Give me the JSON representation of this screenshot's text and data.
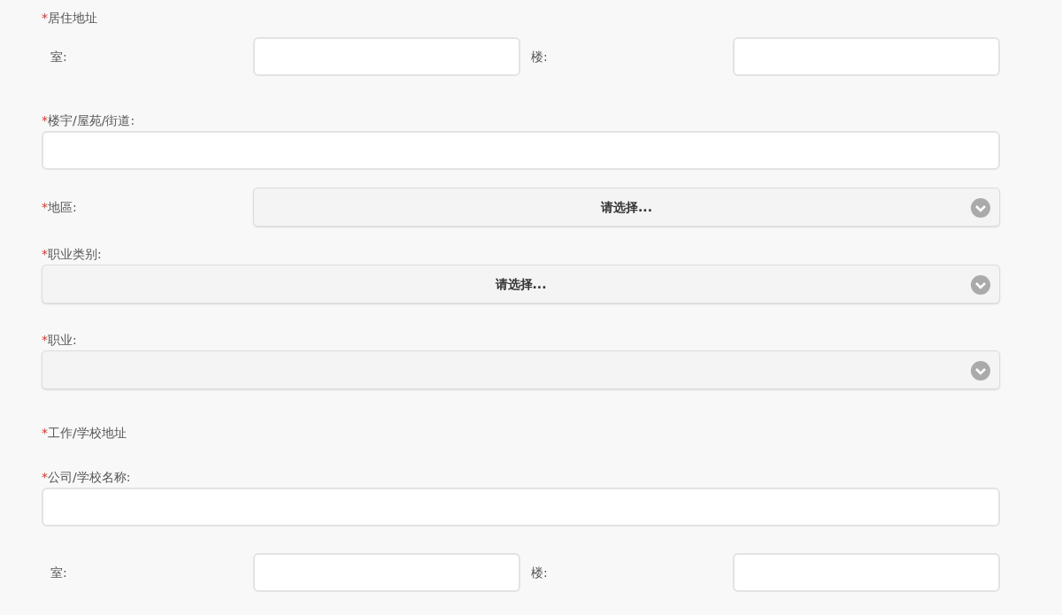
{
  "form": [
    {
      "kind": "heading",
      "marker": "*",
      "label": "居住地址"
    },
    {
      "kind": "pair",
      "fields": [
        {
          "label": "室:"
        },
        {
          "label": "楼:"
        }
      ]
    },
    {
      "kind": "text_stacked",
      "marker": "*",
      "label": "楼宇/屋苑/街道:"
    },
    {
      "kind": "select_inline",
      "marker": "*",
      "label": "地區:",
      "value": "请选择..."
    },
    {
      "kind": "select_stacked",
      "marker": "*",
      "label": "职业类别:",
      "value": "请选择..."
    },
    {
      "kind": "select_stacked",
      "marker": "*",
      "label": "职业:"
    },
    {
      "kind": "heading",
      "marker": "*",
      "label": "工作/学校地址"
    },
    {
      "kind": "text_stacked",
      "marker": "*",
      "label": "公司/学校名称:"
    },
    {
      "kind": "pair",
      "fields": [
        {
          "label": "室:"
        },
        {
          "label": "楼:"
        }
      ]
    }
  ]
}
